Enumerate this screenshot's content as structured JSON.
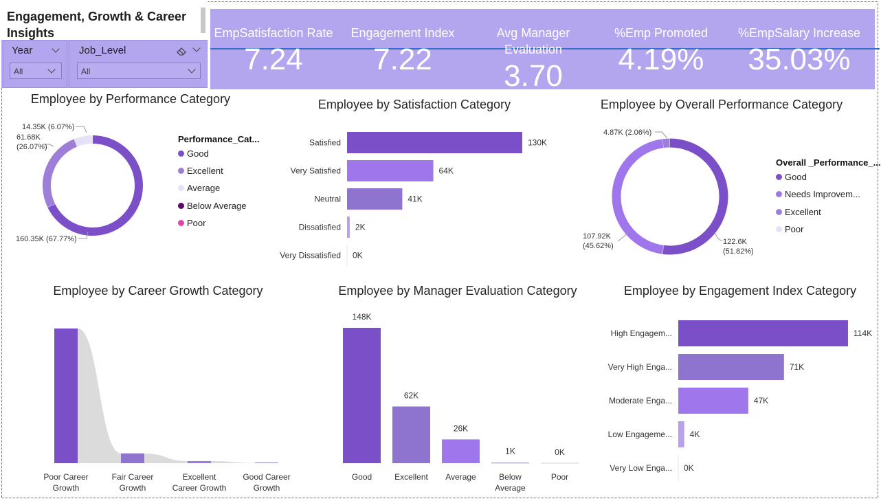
{
  "report": {
    "title": "Engagement, Growth & Career Insights"
  },
  "slicers": [
    {
      "label": "Year",
      "value": "All"
    },
    {
      "label": "Job_Level",
      "value": "All"
    }
  ],
  "kpis": [
    {
      "label": "EmpSatisfaction Rate",
      "value": "7.24"
    },
    {
      "label": "Engagement Index",
      "value": "7.22"
    },
    {
      "label": "Avg Manager Evaluation",
      "value": "3.70"
    },
    {
      "label": "%Emp Promoted",
      "value": "4.19%"
    },
    {
      "label": "%EmpSalary Increase",
      "value": "35.03%"
    }
  ],
  "colors": {
    "kpi_band": "#b4a6ee",
    "dark_purple": "#7b4fc8",
    "mid_purple": "#9f76ec",
    "muted_purple": "#8f74cf",
    "light_lavender": "#e6e1f8",
    "deep_purple": "#5b0a6b",
    "pink": "#e044a6",
    "ribbon_grey": "#dcdbdb",
    "accent_line": "#2f6fc8"
  },
  "chart_data": [
    {
      "type": "pie",
      "title": "Employee by Performance Category",
      "legend_title": "Performance_Cat...",
      "legend": [
        "Good",
        "Excellent",
        "Average",
        "Below Average",
        "Poor"
      ],
      "slices": [
        {
          "name": "Good",
          "value": 160.35,
          "label": "160.35K (67.77%)",
          "color": "#7b4fc8"
        },
        {
          "name": "Excellent",
          "value": 61.68,
          "label": "61.68K (26.07%)",
          "color": "#9d7fd8"
        },
        {
          "name": "Average",
          "value": 14.35,
          "label": "14.35K (6.07%)",
          "color": "#e6e1f8"
        },
        {
          "name": "Below Average",
          "value": 0,
          "label": "",
          "color": "#5b0a6b"
        },
        {
          "name": "Poor",
          "value": 0,
          "label": "",
          "color": "#e044a6"
        }
      ]
    },
    {
      "type": "bar",
      "orientation": "horizontal",
      "title": "Employee by Satisfaction Category",
      "categories": [
        "Satisfied",
        "Very Satisfied",
        "Neutral",
        "Dissatisfied",
        "Very Dissatisfied"
      ],
      "values": [
        130,
        64,
        41,
        2,
        0
      ],
      "value_labels": [
        "130K",
        "64K",
        "41K",
        "2K",
        "0K"
      ],
      "colors": [
        "#7b4fc8",
        "#9f76ec",
        "#8f74cf",
        "#b9a0ee",
        "#e6e1f8"
      ]
    },
    {
      "type": "pie",
      "title": "Employee by Overall Performance Category",
      "legend_title": "Overall _Performance_...",
      "legend": [
        "Good",
        "Needs Improvem...",
        "Excellent",
        "Poor"
      ],
      "slices": [
        {
          "name": "Good",
          "value": 122.6,
          "label": "122.6K (51.82%)",
          "color": "#7b4fc8"
        },
        {
          "name": "Needs Improvement",
          "value": 107.92,
          "label": "107.92K (45.62%)",
          "color": "#9f76ec"
        },
        {
          "name": "Excellent",
          "value": 4.87,
          "label": "4.87K (2.06%)",
          "color": "#9d7fd8"
        },
        {
          "name": "Poor",
          "value": 0,
          "label": "",
          "color": "#e6e1f8"
        }
      ],
      "legend_colors": [
        "#7b4fc8",
        "#9f76ec",
        "#9d7fd8",
        "#e6e1f8"
      ]
    },
    {
      "type": "bar",
      "subtype": "ribbon",
      "title": "Employee by Career Growth Category",
      "categories": [
        "Poor Career Growth",
        "Fair Career Growth",
        "Excellent Career Growth",
        "Good Career Growth"
      ],
      "category_lines": [
        [
          "Poor Career",
          "Growth"
        ],
        [
          "Fair Career",
          "Growth"
        ],
        [
          "Excellent",
          "Career Growth"
        ],
        [
          "Good Career",
          "Growth"
        ]
      ],
      "values": [
        192,
        14,
        3,
        0.5
      ],
      "colors": [
        "#7b4fc8",
        "#8f74cf",
        "#9f76ec",
        "#b9a0ee"
      ]
    },
    {
      "type": "bar",
      "orientation": "vertical",
      "title": "Employee by Manager Evaluation Category",
      "categories": [
        "Good",
        "Excellent",
        "Average",
        "Below Average",
        "Poor"
      ],
      "category_lines": [
        [
          "Good"
        ],
        [
          "Excellent"
        ],
        [
          "Average"
        ],
        [
          "Below",
          "Average"
        ],
        [
          "Poor"
        ]
      ],
      "values": [
        148,
        62,
        26,
        1,
        0
      ],
      "value_labels": [
        "148K",
        "62K",
        "26K",
        "1K",
        "0K"
      ],
      "colors": [
        "#7b4fc8",
        "#8f74cf",
        "#9f76ec",
        "#b9a0ee",
        "#e6e1f8"
      ]
    },
    {
      "type": "bar",
      "orientation": "horizontal",
      "title": "Employee by Engagement Index Category",
      "categories": [
        "High Engagem...",
        "Very High Enga...",
        "Moderate Enga...",
        "Low Engageme...",
        "Very Low Enga..."
      ],
      "values": [
        114,
        71,
        47,
        4,
        0
      ],
      "value_labels": [
        "114K",
        "71K",
        "47K",
        "4K",
        "0K"
      ],
      "colors": [
        "#7b4fc8",
        "#8f74cf",
        "#9f76ec",
        "#b9a0ee",
        "#e6e1f8"
      ]
    }
  ]
}
